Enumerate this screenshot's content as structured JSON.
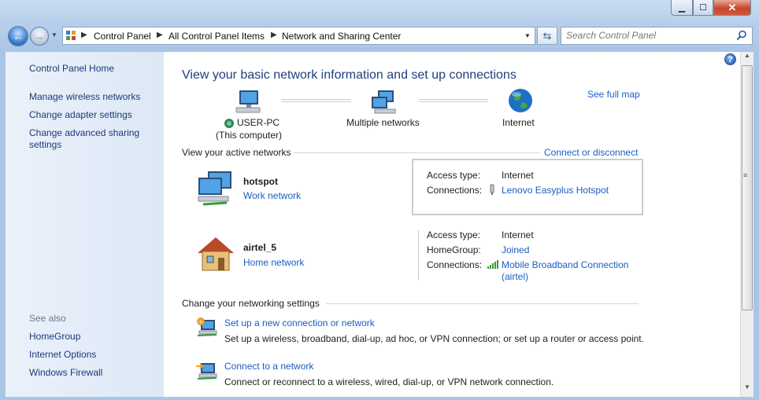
{
  "window": {
    "caption_buttons": {
      "minimize": "▁",
      "maximize": "☐",
      "close": "✕"
    }
  },
  "address_bar": {
    "breadcrumbs": [
      "Control Panel",
      "All Control Panel Items",
      "Network and Sharing Center"
    ],
    "search_placeholder": "Search Control Panel"
  },
  "sidebar": {
    "home": "Control Panel Home",
    "links": [
      "Manage wireless networks",
      "Change adapter settings",
      "Change advanced sharing",
      "settings"
    ],
    "see_also_heading": "See also",
    "see_also": [
      "HomeGroup",
      "Internet Options",
      "Windows Firewall"
    ]
  },
  "main": {
    "title": "View your basic network information and set up connections",
    "see_full_map": "See full map",
    "map": {
      "computer_name": "USER-PC",
      "computer_sub": "(This computer)",
      "middle": "Multiple networks",
      "internet": "Internet"
    },
    "active_heading": "View your active networks",
    "connect_or_disconnect": "Connect or disconnect",
    "networks": [
      {
        "name": "hotspot",
        "type": "Work network",
        "access_label": "Access type:",
        "access_value": "Internet",
        "connections_label": "Connections:",
        "connections_value": "Lenovo Easyplus Hotspot"
      },
      {
        "name": "airtel_5",
        "type": "Home network",
        "access_label": "Access type:",
        "access_value": "Internet",
        "homegroup_label": "HomeGroup:",
        "homegroup_value": "Joined",
        "connections_label": "Connections:",
        "connections_value_1": "Mobile Broadband Connection",
        "connections_value_2": "(airtel)"
      }
    ],
    "change_heading": "Change your networking settings",
    "tasks": [
      {
        "title": "Set up a new connection or network",
        "desc": "Set up a wireless, broadband, dial-up, ad hoc, or VPN connection; or set up a router or access point."
      },
      {
        "title": "Connect to a network",
        "desc": "Connect or reconnect to a wireless, wired, dial-up, or VPN network connection."
      }
    ]
  },
  "colors": {
    "link": "#1a5ec2",
    "heading": "#1e3f7d",
    "sidebar_bg": "#eaf1fa",
    "close_button": "#c8462e"
  }
}
